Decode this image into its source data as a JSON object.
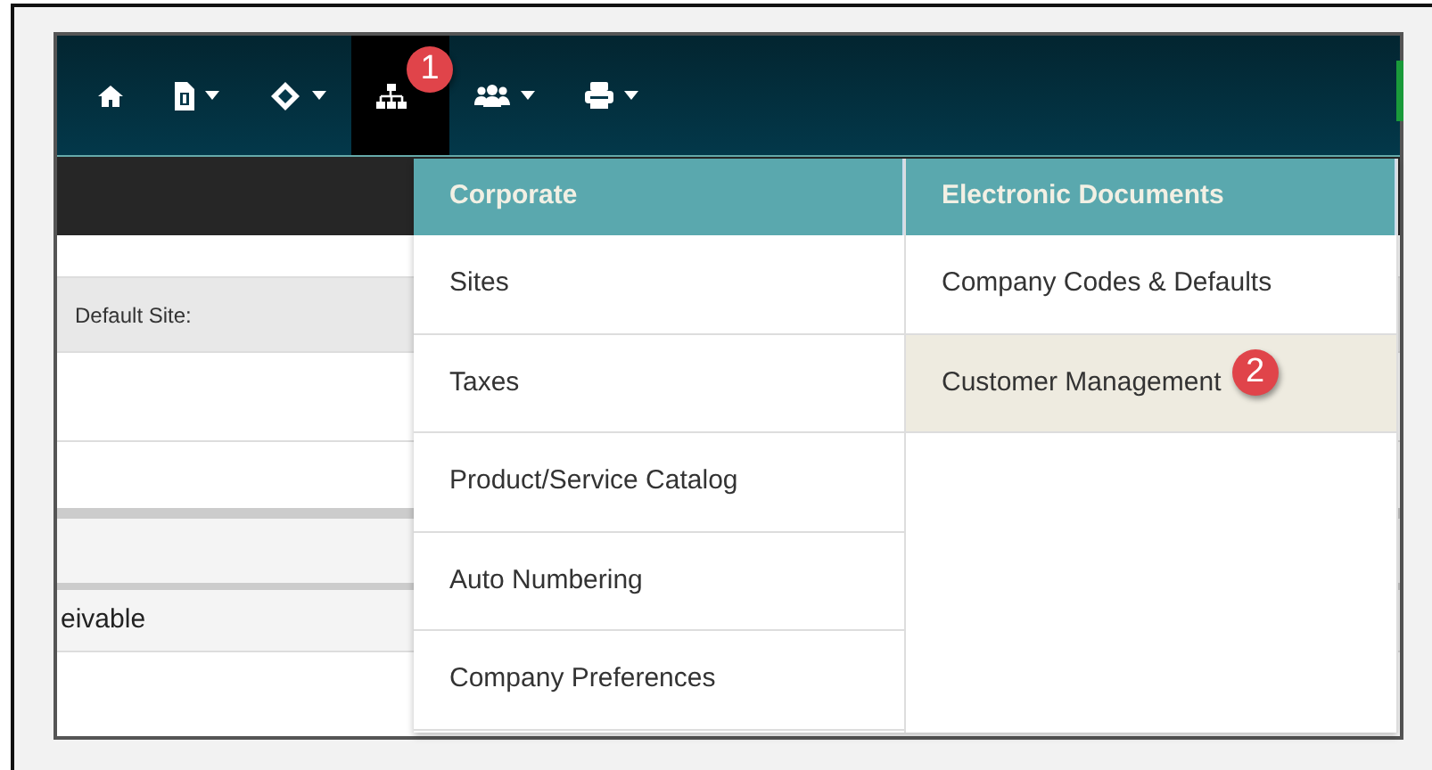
{
  "navbar": {
    "items": [
      {
        "kind": "home",
        "dropdown": false,
        "selected": false
      },
      {
        "kind": "invoice",
        "dropdown": true,
        "selected": false
      },
      {
        "kind": "tag",
        "dropdown": true,
        "selected": false
      },
      {
        "kind": "sitemap",
        "dropdown": false,
        "selected": true,
        "callout": "1"
      },
      {
        "kind": "users",
        "dropdown": true,
        "selected": false
      },
      {
        "kind": "print",
        "dropdown": true,
        "selected": false
      }
    ]
  },
  "background": {
    "field_label": "Default Site:",
    "partial_text": "eivable"
  },
  "menu": {
    "columns": [
      {
        "heading": "Corporate",
        "items": [
          {
            "label": "Sites",
            "highlighted": false
          },
          {
            "label": "Taxes",
            "highlighted": false
          },
          {
            "label": "Product/Service Catalog",
            "highlighted": false
          },
          {
            "label": "Auto Numbering",
            "highlighted": false
          },
          {
            "label": "Company Preferences",
            "highlighted": false
          }
        ]
      },
      {
        "heading": "Electronic Documents",
        "items": [
          {
            "label": "Company Codes & Defaults",
            "highlighted": false
          },
          {
            "label": "Customer Management",
            "highlighted": true,
            "callout": "2"
          }
        ]
      }
    ]
  }
}
